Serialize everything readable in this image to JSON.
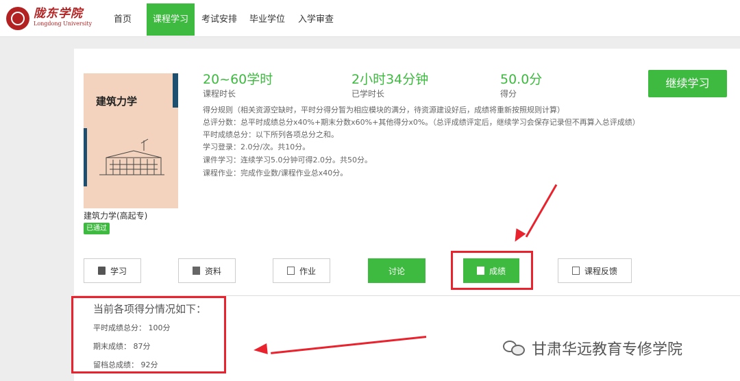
{
  "header": {
    "brand_cn": "陇东学院",
    "brand_en": "Longdong University",
    "nav": [
      "首页",
      "课程学习",
      "考试安排",
      "毕业学位",
      "入学审查"
    ],
    "active_nav": "课程学习"
  },
  "course": {
    "cover_title": "建筑力学",
    "name": "建筑力学(高起专)",
    "status": "已通过",
    "stats": [
      {
        "value": "20~60学时",
        "label": "课程时长"
      },
      {
        "value": "2小时34分钟",
        "label": "已学时长"
      },
      {
        "value": "50.0分",
        "label": "得分"
      }
    ],
    "continue_label": "继续学习",
    "rules": [
      "得分规则（相关资源空缺时，平时分得分暂为相应模块的满分，待资源建设好后，成绩将重新按照规则计算）",
      "总评分数：总平时成绩总分x40%+期末分数x60%+其他得分x0%。（总评成绩评定后，继续学习会保存记录但不再算入总评成绩）",
      "平时成绩总分：以下所列各项总分之和。",
      "学习登录：2.0分/次。共10分。",
      "课件学习：连续学习5.0分钟可得2.0分。共50分。",
      "课程作业：完成作业数/课程作业总x40分。"
    ]
  },
  "tabs": [
    {
      "label": "学习",
      "icon": "book-icon"
    },
    {
      "label": "资料",
      "icon": "document-icon"
    },
    {
      "label": "作业",
      "icon": "edit-icon"
    },
    {
      "label": "讨论",
      "icon": ""
    },
    {
      "label": "成绩",
      "icon": "document-icon"
    },
    {
      "label": "课程反馈",
      "icon": "edit-icon"
    }
  ],
  "scores": {
    "title": "当前各项得分情况如下：",
    "items": [
      "平时成绩总分： 100分",
      "期末成绩： 87分",
      "留档总成绩： 92分"
    ]
  },
  "watermark": "甘肃华远教育专修学院",
  "colors": {
    "accent": "#3dba3f",
    "highlight": "#e8232e",
    "brand": "#b22222"
  }
}
